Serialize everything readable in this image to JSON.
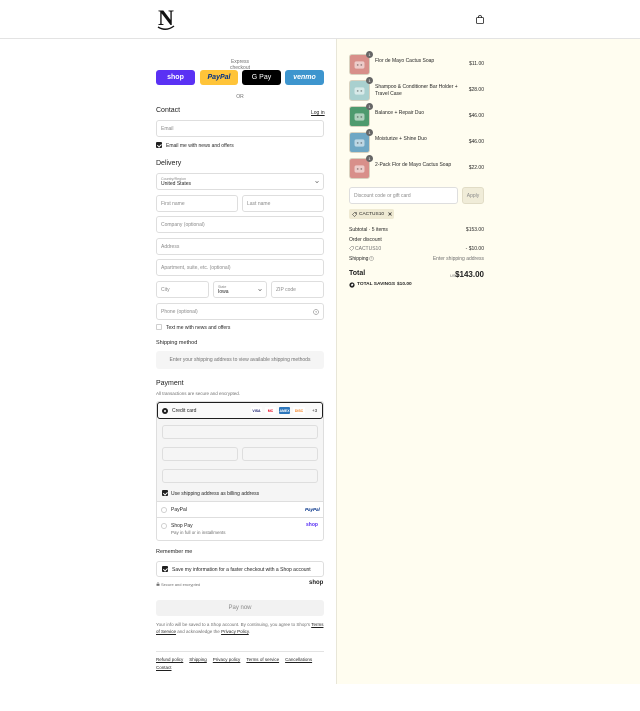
{
  "header": {
    "logo": "N",
    "cart_icon": "shopping-bag-icon"
  },
  "express": {
    "label": "Express checkout",
    "buttons": [
      "shop",
      "PayPal",
      "G Pay",
      "venmo"
    ],
    "or": "OR"
  },
  "contact": {
    "title": "Contact",
    "login": "Log in",
    "email_placeholder": "Email",
    "newsletter_label": "Email me with news and offers",
    "newsletter_checked": true
  },
  "delivery": {
    "title": "Delivery",
    "country_label": "Country/Region",
    "country_value": "United States",
    "first_name": "First name",
    "last_name": "Last name",
    "company": "Company (optional)",
    "address": "Address",
    "apartment": "Apartment, suite, etc. (optional)",
    "city": "City",
    "state_label": "State",
    "state_value": "Iowa",
    "zip": "ZIP code",
    "phone": "Phone (optional)",
    "text_label": "Text me with news and offers"
  },
  "shipping": {
    "title": "Shipping method",
    "message": "Enter your shipping address to view available shipping methods"
  },
  "payment": {
    "title": "Payment",
    "subtitle": "All transactions are secure and encrypted.",
    "credit_card": "Credit card",
    "brands": [
      "VISA",
      "MC",
      "AMEX",
      "DISC"
    ],
    "more_brands": "+3",
    "billing_label": "Use shipping address as billing address",
    "paypal": "PayPal",
    "paypal_logo": "PayPal",
    "shop_pay": "Shop Pay",
    "shop_pay_sub": "Pay in full or in installments",
    "shop_logo": "shop"
  },
  "remember": {
    "title": "Remember me",
    "save_label": "Save my information for a faster checkout with a Shop account",
    "secure": "Secure and encrypted",
    "shop_logo": "shop"
  },
  "pay_now": "Pay now",
  "legal": {
    "pre": "Your info will be saved to a Shop account. By continuing, you agree to Shop's ",
    "terms": "Terms of Service",
    "mid": " and acknowledge the ",
    "privacy": "Privacy Policy",
    "post": "."
  },
  "footer": [
    "Refund policy",
    "Shipping",
    "Privacy policy",
    "Terms of service",
    "Cancellations",
    "Contact"
  ],
  "cart": {
    "items": [
      {
        "name": "Flor de Mayo Cactus Soap",
        "price": "$11.00",
        "qty": "1",
        "color": "#d88f8a"
      },
      {
        "name": "Shampoo & Conditioner Bar Holder + Travel Case",
        "price": "$28.00",
        "qty": "1",
        "color": "#a9d0cf"
      },
      {
        "name": "Balance + Repair Duo",
        "price": "$46.00",
        "qty": "1",
        "color": "#4e9a6e"
      },
      {
        "name": "Moisturize + Shine Duo",
        "price": "$46.00",
        "qty": "1",
        "color": "#6fa7c4"
      },
      {
        "name": "2-Pack Flor de Mayo Cactus Soap",
        "price": "$22.00",
        "qty": "1",
        "color": "#d88f8a"
      }
    ],
    "discount_placeholder": "Discount code or gift card",
    "apply": "Apply",
    "applied_code": "CACTUS10",
    "subtotal_label": "Subtotal · 5 items",
    "subtotal": "$153.00",
    "order_discount": "Order discount",
    "discount_code": "CACTUS10",
    "discount_amount": "- $10.00",
    "shipping_label": "Shipping",
    "shipping_value": "Enter shipping address",
    "total_label": "Total",
    "currency": "USD",
    "total": "$143.00",
    "savings_label": "TOTAL SAVINGS",
    "savings": "$10.00"
  }
}
